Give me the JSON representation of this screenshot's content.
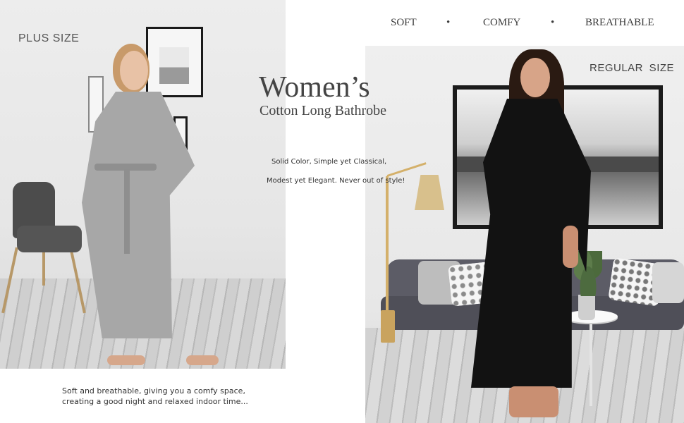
{
  "tagline": {
    "items": [
      "SOFT",
      "COMFY",
      "BREATHABLE"
    ],
    "separator": "•"
  },
  "headline": {
    "title": "Women’s",
    "subtitle": "Cotton Long Bathrobe"
  },
  "description": {
    "line1": "Solid Color, Simple yet Classical,",
    "line2": "Modest yet Elegant. Never out of style!"
  },
  "left_panel": {
    "label": "PLUS SIZE",
    "robe_color": "#a7a7a7"
  },
  "right_panel": {
    "label": "REGULAR  SIZE",
    "robe_color": "#121212"
  },
  "footer": {
    "line1": "Soft and breathable, giving you a comfy space,",
    "line2": "creating a good night and relaxed indoor time..."
  }
}
